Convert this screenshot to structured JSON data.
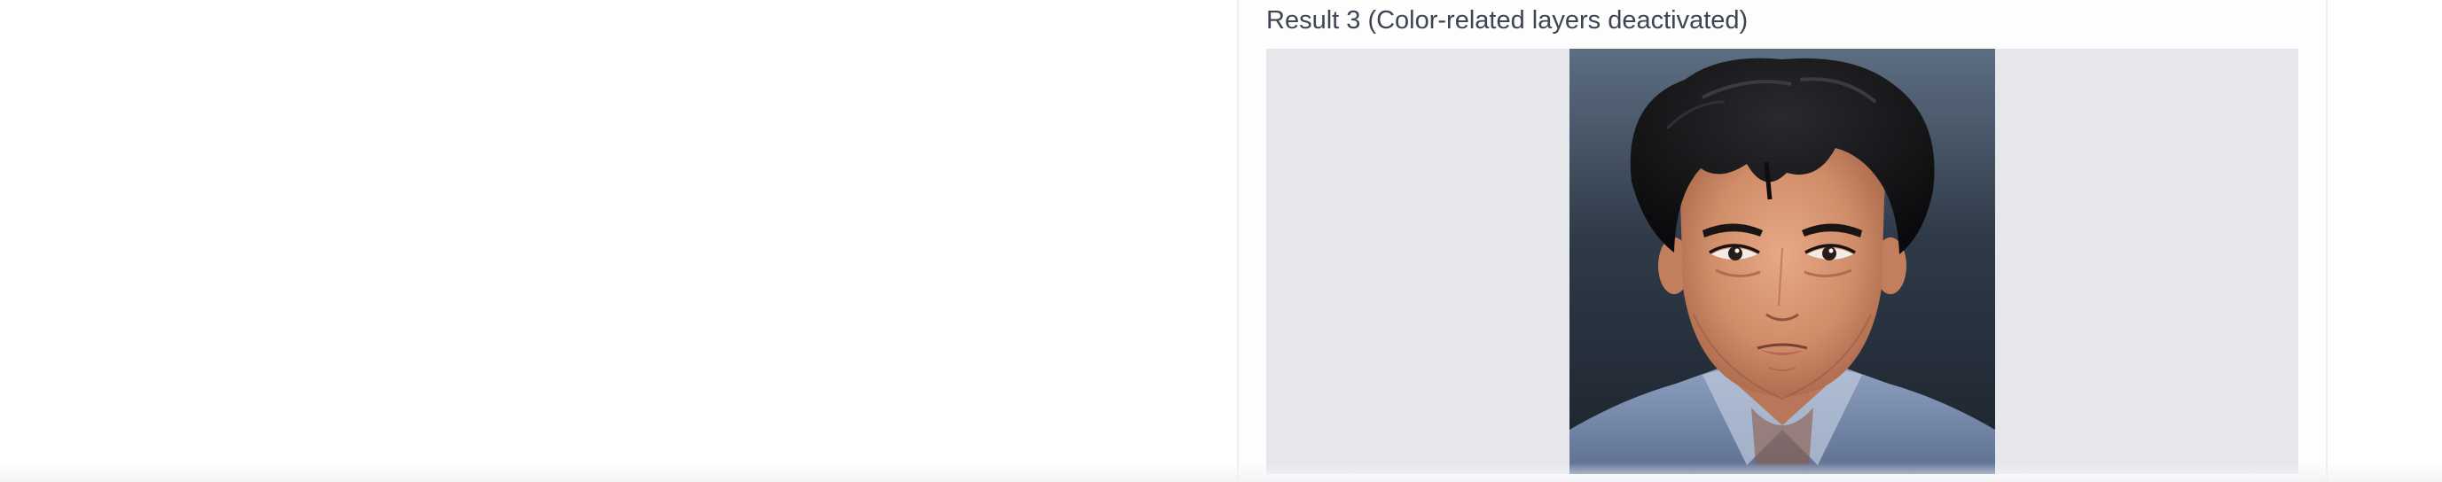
{
  "result": {
    "label": "Result 3 (Color-related layers deactivated)",
    "image_alt": "anime-style portrait of a young man"
  },
  "colors": {
    "frame_background": "#e5e7eb",
    "label_text": "#3e4452",
    "panel_border": "#eceef1"
  }
}
